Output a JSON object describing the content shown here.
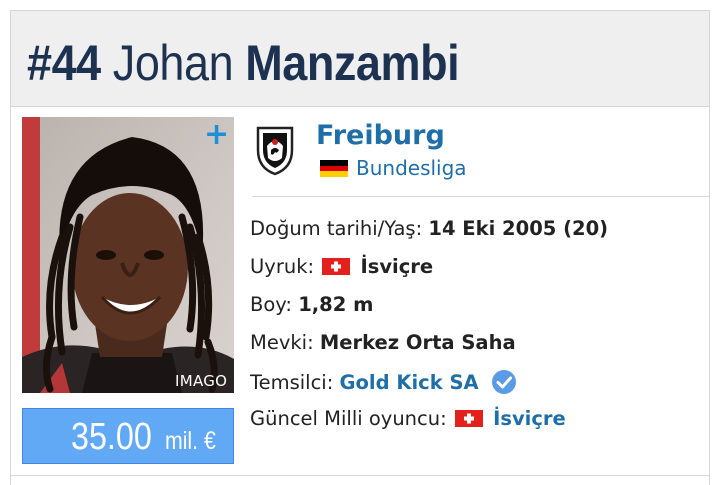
{
  "header": {
    "number": "#44",
    "first_name": "Johan",
    "last_name": "Manzambi"
  },
  "photo": {
    "credit": "IMAGO",
    "add_icon": "plus-icon"
  },
  "market_value": {
    "amount": "35.00",
    "unit": "mil. €"
  },
  "club": {
    "name": "Freiburg",
    "league": "Bundesliga",
    "crest_icon": "freiburg-crest-icon",
    "league_flag_icon": "germany-flag-icon"
  },
  "info": {
    "dob_label": "Doğum tarihi/Yaş:",
    "dob_value": "14 Eki 2005 (20)",
    "nationality_label": "Uyruk:",
    "nationality_value": "İsviçre",
    "height_label": "Boy:",
    "height_value": "1,82 m",
    "position_label": "Mevki:",
    "position_value": "Merkez Orta Saha",
    "agent_label": "Temsilci:",
    "agent_value": "Gold Kick SA",
    "national_label": "Güncel Milli oyuncu:",
    "national_value": "İsviçre"
  },
  "colors": {
    "title": "#1d3150",
    "link": "#1f6ea8",
    "value_bg": "#62a9f5",
    "plus": "#1d8fd9"
  }
}
